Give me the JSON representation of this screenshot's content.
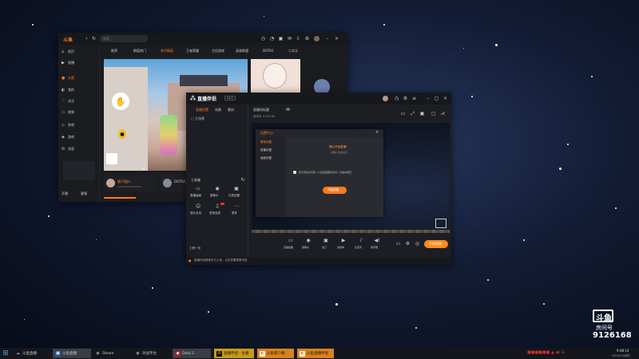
{
  "douyu_client": {
    "title": "斗鱼",
    "search_placeholder": "搜索",
    "tabs": [
      "推荐",
      "颜值热门",
      "和平精英",
      "王者荣耀",
      "主机游戏",
      "英雄联盟",
      "DOTA2",
      "二次元"
    ],
    "sidebar": [
      "首页",
      "直播",
      "分类",
      "我的",
      "关注",
      "视频",
      "鱼吧",
      "游戏",
      "消息"
    ],
    "sidebar_bottom": [
      "开播",
      "客服"
    ],
    "streamer_name": "橘子猫Jin",
    "card2_name": "DOTA2王牌",
    "player_badge": "ID"
  },
  "obs_window": {
    "brand": "直播伴侣",
    "version_badge": "v1.0",
    "left_tabs": [
      "直播设置",
      "场景",
      "素材"
    ],
    "room_title": "直播间标题",
    "room_info": "房间号 9126168",
    "tool_header": "工具箱",
    "tools": [
      {
        "icon": "screen-icon",
        "label": "直播画面"
      },
      {
        "icon": "camera-icon",
        "label": "摄像头"
      },
      {
        "icon": "gift-icon",
        "label": "礼物设置"
      },
      {
        "icon": "user-icon",
        "label": "观众互动"
      },
      {
        "icon": "mic-icon",
        "label": "语音连麦"
      },
      {
        "icon": "more-icon",
        "label": "更多"
      }
    ],
    "more_label": "工具一览",
    "bottom_notice": "直播伴侣新版本已上线，点击查看更新内容",
    "control_labels": [
      "直播画面",
      "摄像头",
      "窗口",
      "多媒体",
      "麦克风",
      "扬声器"
    ],
    "start_button": "开始直播",
    "watermark_num": "斗鱼"
  },
  "dialog": {
    "title": "设置中心",
    "close": "×",
    "sidebar": [
      "基础设置",
      "直播设置",
      "画面设置"
    ],
    "headline": "确认开始直播？",
    "subline": "请确认直播设置",
    "checkbox_label": "我已阅读并同意《斗鱼直播服务协议》及相关规范",
    "confirm_button": "开始直播"
  },
  "watermark": {
    "logo": "斗鱼",
    "room_label": "房间号",
    "room_number": "9126168"
  },
  "taskbar": {
    "start": "⊞",
    "clock_time": "9:48:14",
    "clock_date": "2022/2/16/周三",
    "apps": [
      {
        "label": "斗鱼直播",
        "icon": "cloud"
      },
      {
        "label": "斗鱼直播",
        "icon": "tv"
      },
      {
        "label": "Steam",
        "icon": "steam"
      },
      {
        "label": "对战平台",
        "icon": "steam"
      },
      {
        "label": "Dota 2",
        "icon": "dota"
      },
      {
        "label": "直播伴侣 - 主播",
        "icon": "yellow"
      },
      {
        "label": "斗鱼客户端",
        "icon": "orange"
      },
      {
        "label": "斗鱼直播伴侣",
        "icon": "orange"
      }
    ]
  }
}
